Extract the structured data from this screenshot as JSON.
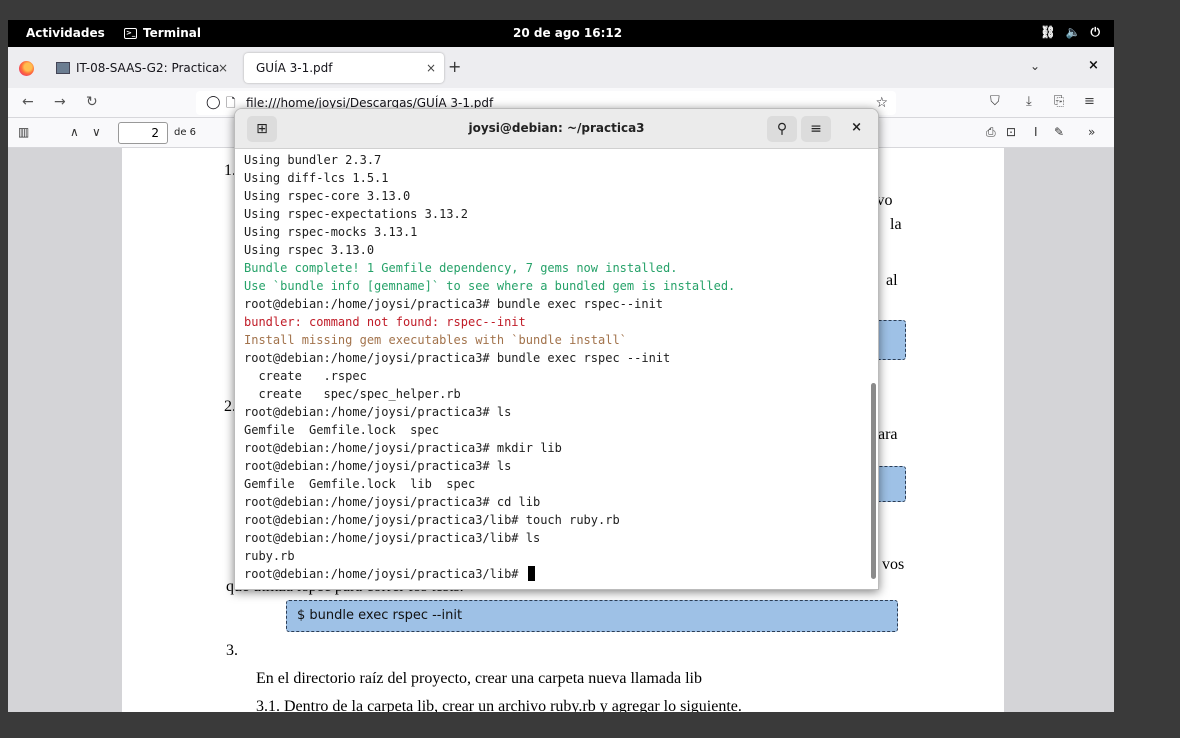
{
  "topbar": {
    "activities": "Actividades",
    "app_name": "Terminal",
    "app_icon_glyph": ">_",
    "clock": "20 de ago  16:12",
    "tray_icons": [
      "network-icon",
      "volume-icon",
      "power-icon"
    ]
  },
  "browser": {
    "tabs": [
      {
        "label": "IT-08-SAAS-G2: Practica",
        "close": "×"
      },
      {
        "label": "GUÍA 3-1.pdf",
        "close": "×"
      }
    ],
    "new_tab": "+",
    "tab_list": "⌄",
    "window_close": "×",
    "url": "file:///home/joysi/Descargas/GUÍA 3-1.pdf",
    "pdf_toolbar": {
      "page_number": "2",
      "page_count": "de 6"
    }
  },
  "pdf_page": {
    "item_1": "1.",
    "frag_ivo": "ivo",
    "frag_la": "la",
    "frag_al": "al",
    "item_2": "2.",
    "frag_ara": "ara",
    "frag_vos": "vos",
    "line_rspec": "que utiliza rspec para correr los tests.",
    "code_init": "$ bundle exec rspec --init",
    "item_3": "3.",
    "line_lib": "En el directorio raíz del proyecto, crear una carpeta nueva llamada lib",
    "line_31": "3.1. Dentro de la carpeta lib, crear un archivo ruby.rb y agregar lo siguiente."
  },
  "terminal": {
    "title": "joysi@debian: ~/practica3",
    "lines": [
      {
        "text": "Using bundler 2.3.7",
        "style": "normal"
      },
      {
        "text": "Using diff-lcs 1.5.1",
        "style": "normal"
      },
      {
        "text": "Using rspec-core 3.13.0",
        "style": "normal"
      },
      {
        "text": "Using rspec-expectations 3.13.2",
        "style": "normal"
      },
      {
        "text": "Using rspec-mocks 3.13.1",
        "style": "normal"
      },
      {
        "text": "Using rspec 3.13.0",
        "style": "normal"
      },
      {
        "text": "Bundle complete! 1 Gemfile dependency, 7 gems now installed.",
        "style": "green"
      },
      {
        "text": "Use `bundle info [gemname]` to see where a bundled gem is installed.",
        "style": "green"
      },
      {
        "text": "root@debian:/home/joysi/practica3# bundle exec rspec--init",
        "style": "normal"
      },
      {
        "text": "bundler: command not found: rspec--init",
        "style": "red"
      },
      {
        "text": "Install missing gem executables with `bundle install`",
        "style": "orange"
      },
      {
        "text": "root@debian:/home/joysi/practica3# bundle exec rspec --init",
        "style": "normal"
      },
      {
        "text": "  create   .rspec",
        "style": "normal"
      },
      {
        "text": "  create   spec/spec_helper.rb",
        "style": "normal"
      },
      {
        "text": "root@debian:/home/joysi/practica3# ls",
        "style": "normal"
      },
      {
        "text": "Gemfile  Gemfile.lock  spec",
        "style": "normal"
      },
      {
        "text": "root@debian:/home/joysi/practica3# mkdir lib",
        "style": "normal"
      },
      {
        "text": "root@debian:/home/joysi/practica3# ls",
        "style": "normal"
      },
      {
        "text": "Gemfile  Gemfile.lock  lib  spec",
        "style": "normal"
      },
      {
        "text": "root@debian:/home/joysi/practica3# cd lib",
        "style": "normal"
      },
      {
        "text": "root@debian:/home/joysi/practica3/lib# touch ruby.rb",
        "style": "normal"
      },
      {
        "text": "root@debian:/home/joysi/practica3/lib# ls",
        "style": "normal"
      },
      {
        "text": "ruby.rb",
        "style": "normal"
      }
    ],
    "prompt": "root@debian:/home/joysi/practica3/lib# "
  },
  "colors": {
    "terminal_green": "#26a269",
    "terminal_red": "#c01c28",
    "terminal_orange": "#a2734c",
    "code_box": "#9ec1e6"
  }
}
